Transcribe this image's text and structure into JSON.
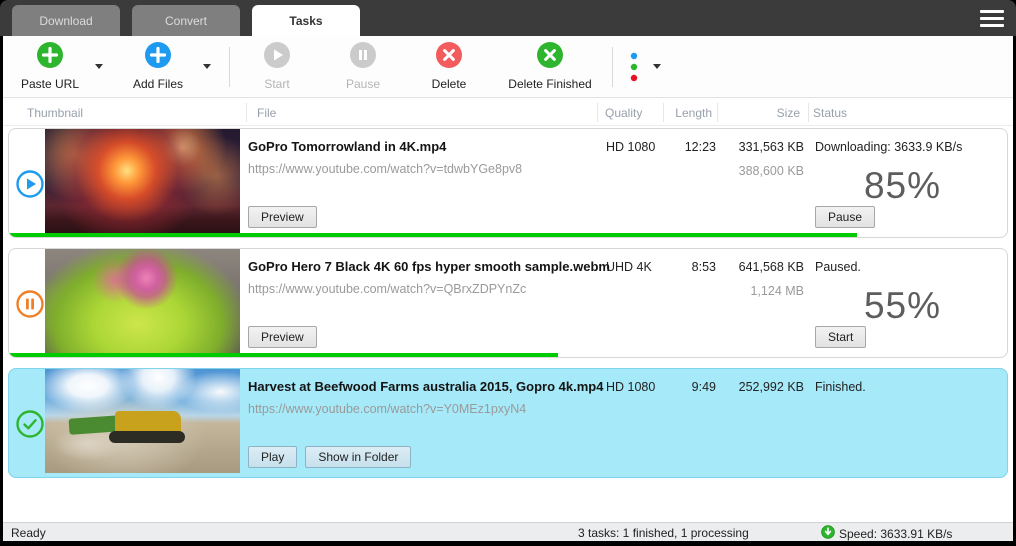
{
  "tabs": [
    {
      "label": "Download",
      "active": false
    },
    {
      "label": "Convert",
      "active": false
    },
    {
      "label": "Tasks",
      "active": true
    }
  ],
  "toolbar": {
    "paste_url": "Paste URL",
    "add_files": "Add Files",
    "start": "Start",
    "pause": "Pause",
    "delete": "Delete",
    "delete_finished": "Delete Finished"
  },
  "colors": {
    "green": "#2db52d",
    "blue": "#1e9aef",
    "red": "#f25c5c",
    "orange": "#f08028",
    "progress_green": "#00ca00",
    "selected_row": "#a6e9f8"
  },
  "table": {
    "headers": [
      "Thumbnail",
      "File",
      "Quality",
      "Length",
      "Size",
      "Status"
    ]
  },
  "tasks": [
    {
      "title": "GoPro  Tomorrowland in 4K.mp4",
      "url": "https://www.youtube.com/watch?v=tdwbYGe8pv8",
      "quality": "HD 1080",
      "length": "12:23",
      "size": "331,563 KB",
      "size_total": "388,600 KB",
      "status": "Downloading: 3633.9 KB/s",
      "percent": "85%",
      "progress": 85,
      "preview_label": "Preview",
      "action_label": "Pause",
      "state_icon": "play-icon",
      "selected": false
    },
    {
      "title": "GoPro Hero 7 Black 4K 60 fps hyper smooth sample.webm",
      "url": "https://www.youtube.com/watch?v=QBrxZDPYnZc",
      "quality": "UHD 4K",
      "length": "8:53",
      "size": "641,568 KB",
      "size_total": "1,124 MB",
      "status": "Paused.",
      "percent": "55%",
      "progress": 55,
      "preview_label": "Preview",
      "action_label": "Start",
      "state_icon": "pause-icon",
      "selected": false
    },
    {
      "title": "Harvest at Beefwood Farms australia 2015, Gopro 4k.mp4",
      "url": "https://www.youtube.com/watch?v=Y0MEz1pxyN4",
      "quality": "HD 1080",
      "length": "9:49",
      "size": "252,992 KB",
      "size_total": "",
      "status": "Finished.",
      "percent": "",
      "progress": 0,
      "play_label": "Play",
      "show_in_folder_label": "Show in Folder",
      "state_icon": "check-icon",
      "selected": true
    }
  ],
  "statusbar": {
    "left": "Ready",
    "center": "3 tasks: 1 finished, 1 processing",
    "right": "Speed: 3633.91 KB/s"
  }
}
